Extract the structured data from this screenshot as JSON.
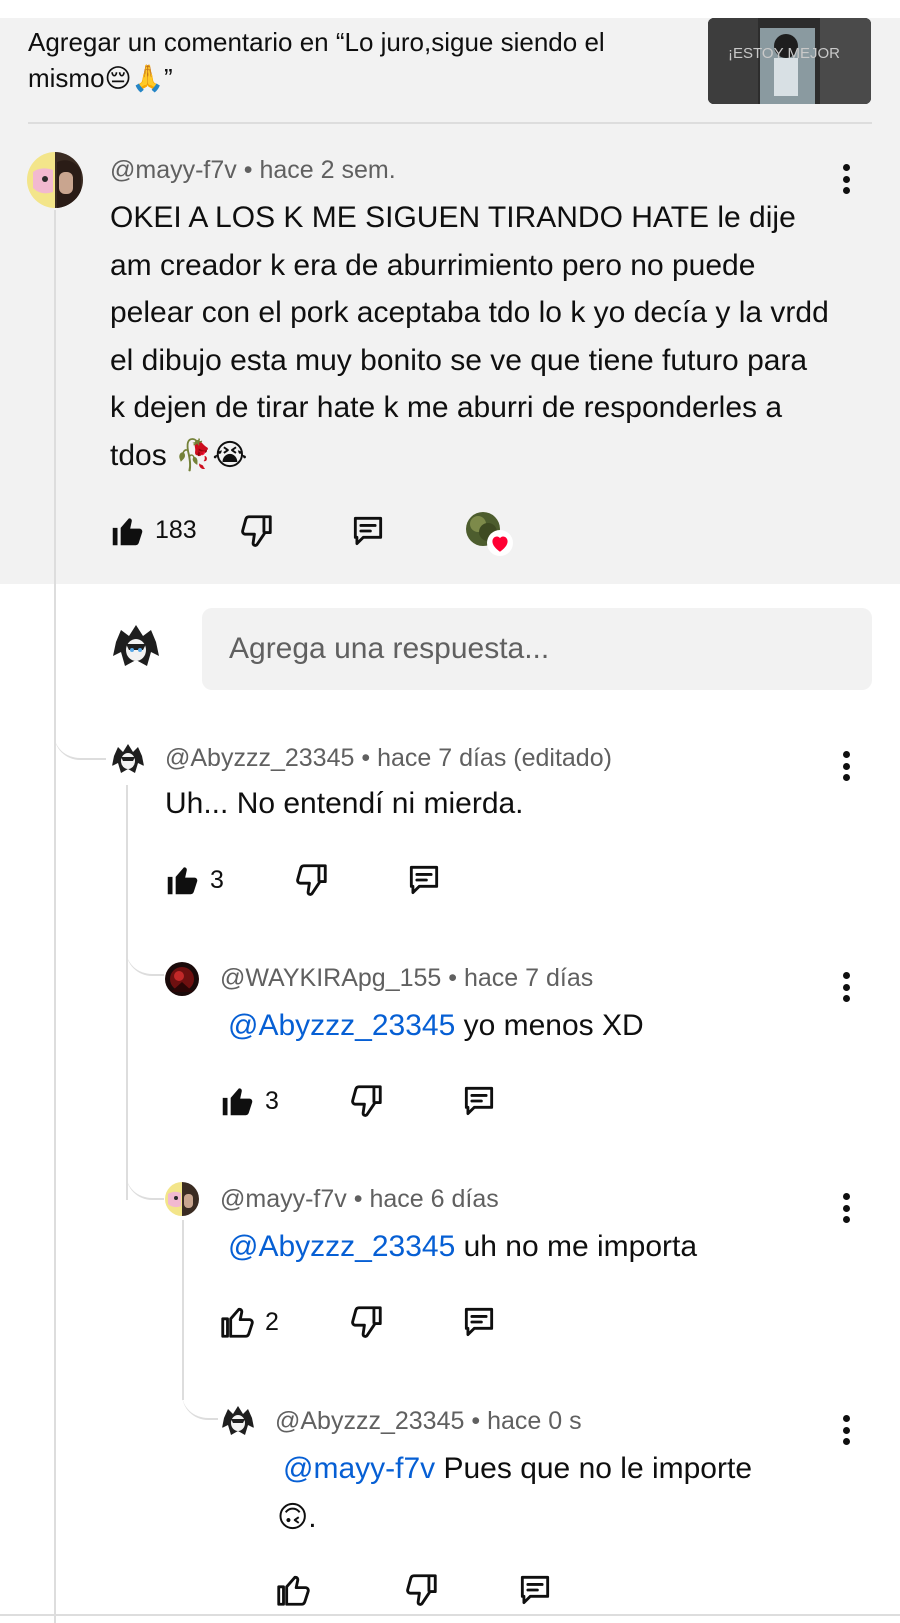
{
  "video_context": {
    "text": "Agregar un comentario en “Lo juro,sigue siendo el mismo😔🙏”",
    "thumbnail_text": "¡ESTOY MEJOR"
  },
  "main_comment": {
    "author": "@mayy-f7v",
    "time": "hace 2 sem.",
    "text": "OKEI A LOS K ME SIGUEN TIRANDO HATE le dije am creador k era de aburrimiento pero no puede pelear con el pork aceptaba tdo lo k yo decía y la vrdd el dibujo esta muy bonito se ve que tiene futuro para k dejen de tirar hate k me aburri de responderles a tdos 🥀😭",
    "likes": "183",
    "creator_heart": "heart-badge"
  },
  "reply_box": {
    "placeholder": "Agrega una respuesta..."
  },
  "replies": [
    {
      "author": "@Abyzzz_23345",
      "time": "hace 7 días (editado)",
      "mention": "",
      "text": "Uh... No entendí ni mierda.",
      "likes": "3"
    },
    {
      "author": "@WAYKIRApg_155",
      "time": "hace 7 días",
      "mention": "@Abyzzz_23345",
      "text": " yo menos XD",
      "likes": "3"
    },
    {
      "author": "@mayy-f7v",
      "time": "hace 6 días",
      "mention": "@Abyzzz_23345",
      "text": " uh no me importa",
      "likes": "2"
    },
    {
      "author": "@Abyzzz_23345",
      "time": "hace 0 s",
      "mention": "@mayy-f7v",
      "text": "  Pues que no le importe",
      "text_line2": "🙃.",
      "likes": ""
    }
  ],
  "separator": "•",
  "colors": {
    "background": "#ffffff",
    "highlight": "#f2f2f2",
    "mention": "#065fd4",
    "secondary_text": "#606060",
    "heart": "#ff0033"
  }
}
